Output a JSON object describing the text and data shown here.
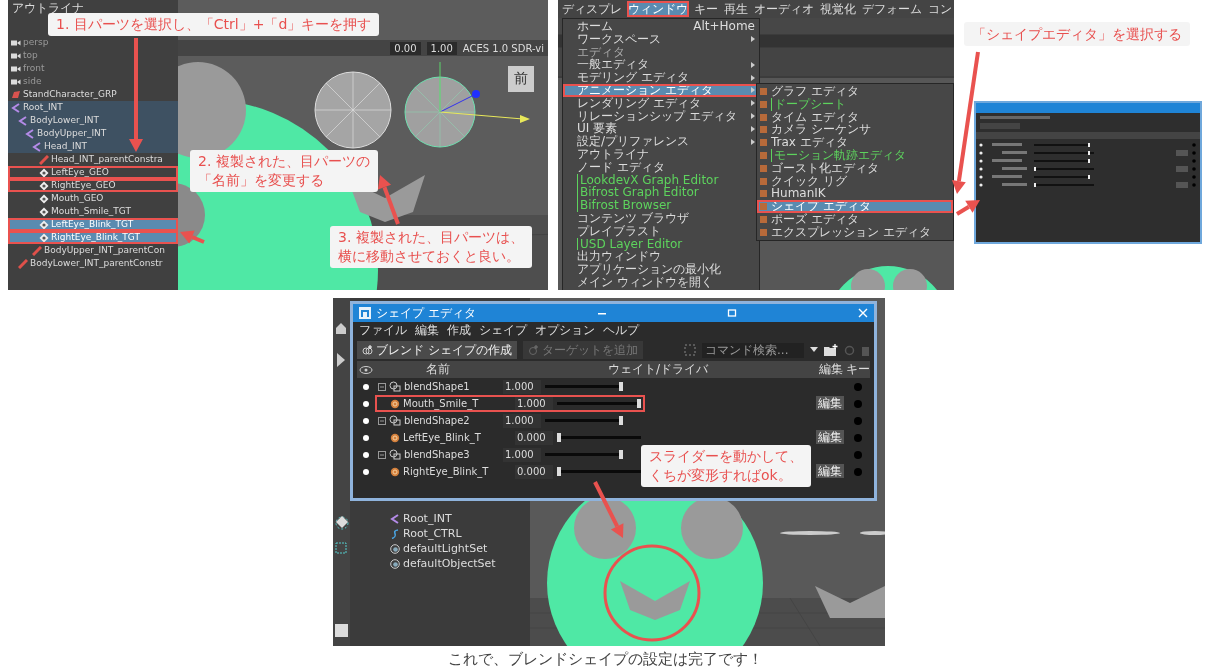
{
  "step_panel": {
    "outliner": {
      "title": "アウトライナ",
      "items": [
        {
          "label": "persp",
          "kind": "camera",
          "selected": false,
          "highlighted": false,
          "framed": false
        },
        {
          "label": "top",
          "kind": "camera",
          "selected": false,
          "highlighted": false,
          "framed": false
        },
        {
          "label": "front",
          "kind": "camera",
          "selected": false,
          "highlighted": false,
          "framed": false
        },
        {
          "label": "side",
          "kind": "camera",
          "selected": false,
          "highlighted": false,
          "framed": false
        },
        {
          "label": "StandCharacter_GRP",
          "kind": "group",
          "selected": false,
          "highlighted": false,
          "framed": false
        },
        {
          "label": "Root_INT",
          "kind": "joint",
          "selected": false,
          "highlighted": true,
          "framed": false,
          "children": [
            {
              "label": "BodyLower_INT",
              "kind": "joint",
              "selected": false,
              "highlighted": true,
              "framed": false,
              "children": [
                {
                  "label": "BodyUpper_INT",
                  "kind": "joint",
                  "selected": false,
                  "highlighted": true,
                  "framed": false,
                  "children": [
                    {
                      "label": "Head_INT",
                      "kind": "joint",
                      "selected": false,
                      "highlighted": true,
                      "framed": false,
                      "children": [
                        {
                          "label": "Head_INT_parentConstra",
                          "kind": "constraint",
                          "selected": false,
                          "highlighted": false,
                          "framed": false
                        },
                        {
                          "label": "LeftEye_GEO",
                          "kind": "mesh",
                          "selected": false,
                          "highlighted": false,
                          "framed": true
                        },
                        {
                          "label": "RightEye_GEO",
                          "kind": "mesh",
                          "selected": false,
                          "highlighted": false,
                          "framed": true
                        },
                        {
                          "label": "Mouth_GEO",
                          "kind": "mesh",
                          "selected": false,
                          "highlighted": false,
                          "framed": false
                        },
                        {
                          "label": "Mouth_Smile_TGT",
                          "kind": "mesh",
                          "selected": false,
                          "highlighted": false,
                          "framed": false
                        },
                        {
                          "label": "LeftEye_Blink_TGT",
                          "kind": "mesh",
                          "selected": true,
                          "highlighted": false,
                          "framed": true
                        },
                        {
                          "label": "RightEye_Blink_TGT",
                          "kind": "mesh",
                          "selected": true,
                          "highlighted": false,
                          "framed": true
                        }
                      ]
                    },
                    {
                      "label": "BodyUpper_INT_parentCon",
                      "kind": "constraint",
                      "selected": false,
                      "highlighted": false,
                      "framed": false
                    }
                  ]
                }
              ]
            },
            {
              "label": "BodyLower_INT_parentConstr",
              "kind": "constraint",
              "selected": false,
              "highlighted": false,
              "framed": false
            }
          ]
        }
      ]
    },
    "viewport": {
      "values": [
        "0.00",
        "1.00"
      ],
      "color_space": "ACES 1.0 SDR-vi",
      "view_cube_label": "前"
    },
    "callouts": [
      {
        "lines": [
          "1. 目パーツを選択し、「Ctrl」+「d」キーを押す"
        ]
      },
      {
        "lines": [
          "2. 複製された、目パーツの",
          "「名前」を変更する"
        ]
      },
      {
        "lines": [
          "3. 複製された、目パーツは、",
          "横に移動させておくと良い。"
        ]
      }
    ]
  },
  "menu_panel": {
    "menubar": [
      {
        "label": "ディスプレ",
        "selected": false,
        "framed": false
      },
      {
        "label": "ウィンドウ",
        "selected": true,
        "framed": true
      },
      {
        "label": "キー",
        "selected": false,
        "framed": false
      },
      {
        "label": "再生",
        "selected": false,
        "framed": false
      },
      {
        "label": "オーディオ",
        "selected": false,
        "framed": false
      },
      {
        "label": "視覚化",
        "selected": false,
        "framed": false
      },
      {
        "label": "デフォーム",
        "selected": false,
        "framed": false
      },
      {
        "label": "コン",
        "selected": false,
        "framed": false
      }
    ],
    "window_menu": [
      {
        "kind": "item",
        "label": "ホーム",
        "shortcut": "Alt+Home",
        "submenu": false,
        "selected": false,
        "framed": false
      },
      {
        "kind": "item",
        "label": "ワークスペース",
        "submenu": true,
        "selected": false,
        "framed": false
      },
      {
        "kind": "heading",
        "label": "エディタ",
        "submenu": false,
        "selected": false,
        "framed": false
      },
      {
        "kind": "item",
        "label": "一般エディタ",
        "submenu": true,
        "selected": false,
        "framed": false
      },
      {
        "kind": "item",
        "label": "モデリング エディタ",
        "submenu": true,
        "selected": false,
        "framed": false
      },
      {
        "kind": "item",
        "label": "アニメーション エディタ",
        "submenu": true,
        "selected": true,
        "framed": true
      },
      {
        "kind": "item",
        "label": "レンダリング エディタ",
        "submenu": true,
        "selected": false,
        "framed": false
      },
      {
        "kind": "item",
        "label": "リレーションシップ エディタ",
        "submenu": true,
        "selected": false,
        "framed": false
      },
      {
        "kind": "item",
        "label": "UI 要素",
        "submenu": true,
        "selected": false,
        "framed": false
      },
      {
        "kind": "item",
        "label": "設定/プリファレンス",
        "submenu": true,
        "selected": false,
        "framed": false
      },
      {
        "kind": "item",
        "label": "アウトライナ",
        "submenu": false,
        "selected": false,
        "framed": false
      },
      {
        "kind": "item",
        "label": "ノード エディタ",
        "submenu": false,
        "selected": false,
        "framed": false
      },
      {
        "kind": "plugin",
        "label": "LookdevX Graph Editor",
        "submenu": false,
        "selected": false,
        "framed": false
      },
      {
        "kind": "plugin",
        "label": "Bifrost Graph Editor",
        "submenu": false,
        "selected": false,
        "framed": false
      },
      {
        "kind": "plugin",
        "label": "Bifrost Browser",
        "submenu": false,
        "selected": false,
        "framed": false
      },
      {
        "kind": "item",
        "label": "コンテンツ ブラウザ",
        "submenu": false,
        "selected": false,
        "framed": false
      },
      {
        "kind": "item",
        "label": "プレイブラスト",
        "submenu": false,
        "selected": false,
        "framed": false
      },
      {
        "kind": "plugin",
        "label": "USD Layer Editor",
        "submenu": false,
        "selected": false,
        "framed": false
      },
      {
        "kind": "item",
        "label": "出力ウィンドウ",
        "submenu": false,
        "selected": false,
        "framed": false
      },
      {
        "kind": "item",
        "label": "アプリケーションの最小化",
        "submenu": false,
        "selected": false,
        "framed": false
      },
      {
        "kind": "item",
        "label": "メイン ウィンドウを開く",
        "submenu": false,
        "selected": false,
        "framed": false
      }
    ],
    "animation_submenu": [
      {
        "kind": "item",
        "label": "グラフ エディタ",
        "selected": false,
        "framed": false
      },
      {
        "kind": "plugin",
        "label": "ドープシート",
        "selected": false,
        "framed": false
      },
      {
        "kind": "item",
        "label": "タイム エディタ",
        "selected": false,
        "framed": false
      },
      {
        "kind": "item",
        "label": "カメラ シーケンサ",
        "selected": false,
        "framed": false
      },
      {
        "kind": "item",
        "label": "Trax エディタ",
        "selected": false,
        "framed": false
      },
      {
        "kind": "plugin",
        "label": "モーション軌跡エディタ",
        "selected": false,
        "framed": false
      },
      {
        "kind": "item",
        "label": "ゴースト化エディタ",
        "selected": false,
        "framed": false
      },
      {
        "kind": "item",
        "label": "クイック リグ",
        "selected": false,
        "framed": false
      },
      {
        "kind": "item",
        "label": "HumanIK",
        "selected": false,
        "framed": false
      },
      {
        "kind": "item",
        "label": "シェイプ エディタ",
        "selected": true,
        "framed": true
      },
      {
        "kind": "item",
        "label": "ポーズ エディタ",
        "selected": false,
        "framed": false
      },
      {
        "kind": "item",
        "label": "エクスプレッション エディタ",
        "selected": false,
        "framed": false
      }
    ]
  },
  "preview_panel": {
    "callout": "「シェイプエディタ」を選択する"
  },
  "shape_panel": {
    "editor": {
      "title": "シェイプ エディタ",
      "menus": [
        "ファイル",
        "編集",
        "作成",
        "シェイプ",
        "オプション",
        "ヘルプ"
      ],
      "create_button": "ブレンド シェイプの作成",
      "add_target_button": {
        "label": "ターゲットを追加",
        "disabled": true
      },
      "search_placeholder": "コマンド検索...",
      "columns": [
        "名前",
        "ウェイト/ドライバ",
        "編集",
        "キー"
      ],
      "rows": [
        {
          "kind": "blend_shape",
          "name": "blendShape1",
          "value": "1.000",
          "level": 1,
          "framed": false,
          "children": [
            {
              "kind": "target",
              "name": "Mouth_Smile_T",
              "value": "1.000",
              "level": 1,
              "framed": true,
              "edit": "編集"
            }
          ]
        },
        {
          "kind": "blend_shape",
          "name": "blendShape2",
          "value": "1.000",
          "level": 1,
          "framed": false,
          "children": [
            {
              "kind": "target",
              "name": "LeftEye_Blink_T",
              "value": "0.000",
              "level": 0,
              "framed": false,
              "edit": "編集"
            }
          ]
        },
        {
          "kind": "blend_shape",
          "name": "blendShape3",
          "value": "1.000",
          "level": 1,
          "framed": false,
          "children": [
            {
              "kind": "target",
              "name": "RightEye_Blink_T",
              "value": "0.000",
              "level": 0,
              "framed": false,
              "edit": "編集"
            }
          ]
        }
      ]
    },
    "outliner": [
      {
        "kind": "joint",
        "label": "Root_INT"
      },
      {
        "kind": "curve",
        "label": "Root_CTRL"
      },
      {
        "kind": "set",
        "label": "defaultLightSet"
      },
      {
        "kind": "set",
        "label": "defaultObjectSet"
      }
    ],
    "callout": {
      "lines": [
        "スライダーを動かして、",
        "くちが変形すればok。"
      ]
    }
  },
  "caption": "これで、ブレンドシェイプの設定は完了です！"
}
